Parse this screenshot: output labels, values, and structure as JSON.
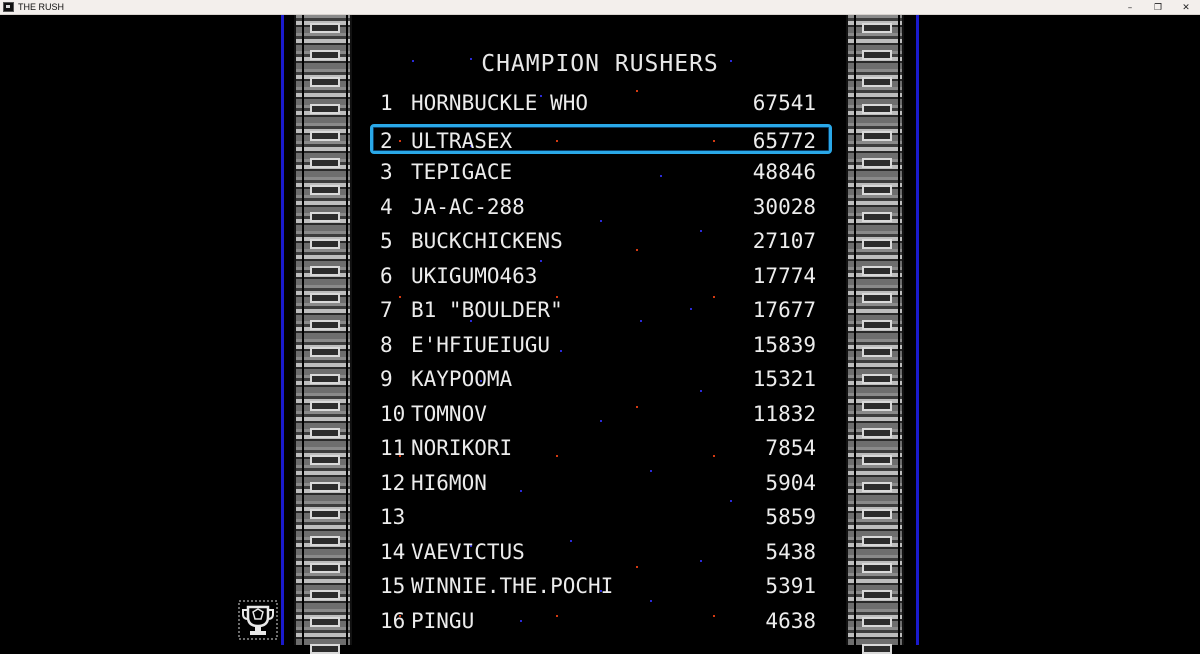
{
  "window": {
    "title": "THE RUSH",
    "minimize_glyph": "–",
    "restore_glyph": "❐",
    "close_glyph": "✕"
  },
  "leaderboard": {
    "title": "CHAMPION RUSHERS",
    "selected_rank": 2,
    "entries": [
      {
        "rank": "1",
        "name": "HORNBUCKLE WHO",
        "score": "67541"
      },
      {
        "rank": "2",
        "name": "ULTRASEX",
        "score": "65772"
      },
      {
        "rank": "3",
        "name": "TEPIGACE",
        "score": "48846"
      },
      {
        "rank": "4",
        "name": "JA-AC-288",
        "score": "30028"
      },
      {
        "rank": "5",
        "name": "BUCKCHICKENS",
        "score": "27107"
      },
      {
        "rank": "6",
        "name": "UKIGUMO463",
        "score": "17774"
      },
      {
        "rank": "7",
        "name": "B1 \"BOULDER\"",
        "score": "17677"
      },
      {
        "rank": "8",
        "name": "E'HFIUEIUGU",
        "score": "15839"
      },
      {
        "rank": "9",
        "name": "KAYPOOMA",
        "score": "15321"
      },
      {
        "rank": "10",
        "name": "TOMNOV",
        "score": "11832"
      },
      {
        "rank": "11",
        "name": "NORIKORI",
        "score": "7854"
      },
      {
        "rank": "12",
        "name": "HI6MON",
        "score": "5904"
      },
      {
        "rank": "13",
        "name": "",
        "score": "5859"
      },
      {
        "rank": "14",
        "name": "VAEVICTUS",
        "score": "5438"
      },
      {
        "rank": "15",
        "name": "WINNIE.THE.POCHI",
        "score": "5391"
      },
      {
        "rank": "16",
        "name": "PINGU",
        "score": "4638"
      }
    ]
  },
  "icons": {
    "app": "app-icon",
    "trophy": "trophy-icon"
  },
  "colors": {
    "background": "#000000",
    "text": "#ececec",
    "selection_border": "#2aa8e8",
    "side_line": "#1a1acc",
    "star_red": "#d43a12",
    "star_blue": "#2a2ad8"
  }
}
